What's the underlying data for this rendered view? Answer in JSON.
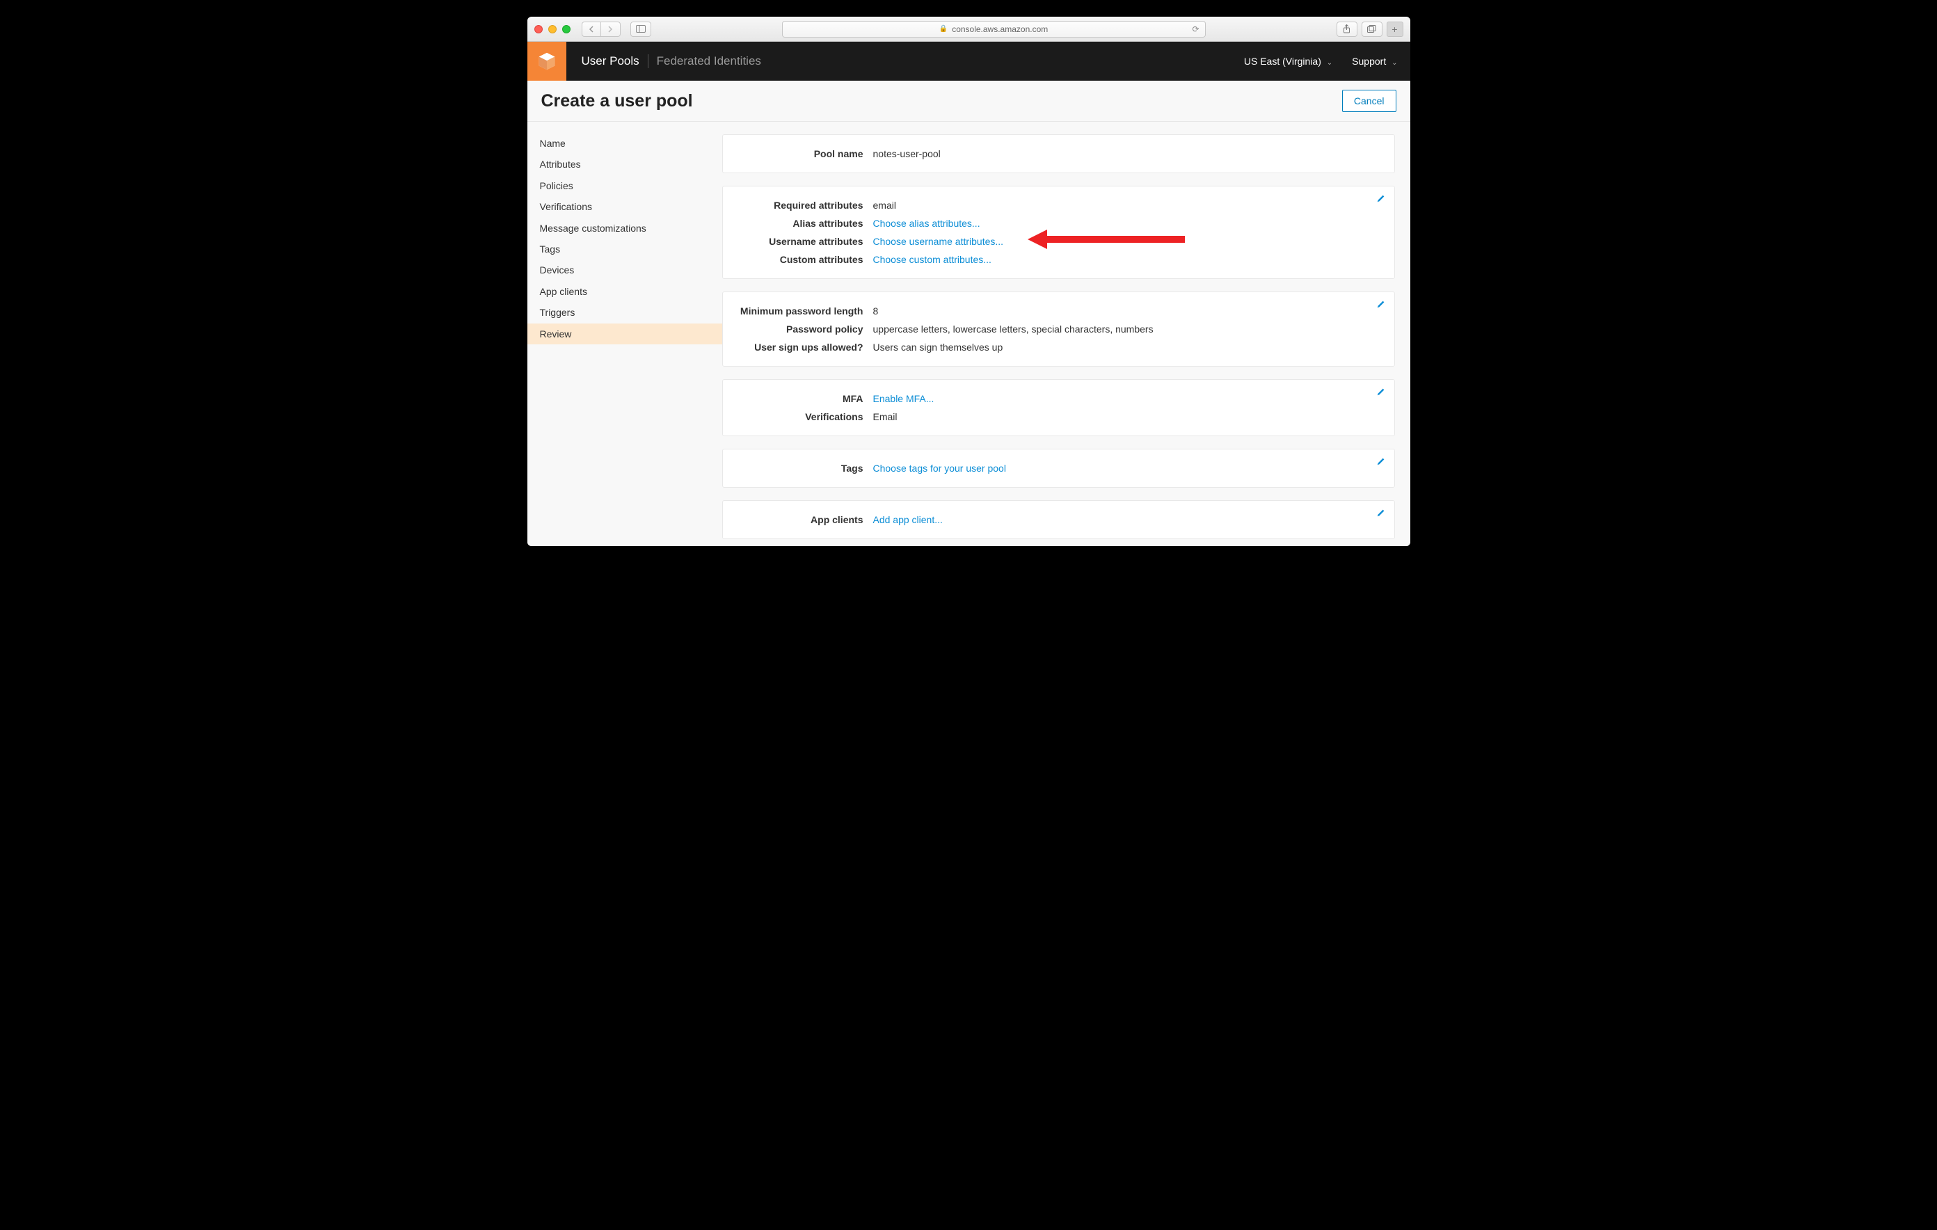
{
  "browser": {
    "url_host": "console.aws.amazon.com"
  },
  "aws_header": {
    "nav_primary": "User Pools",
    "nav_secondary": "Federated Identities",
    "region": "US East (Virginia)",
    "support": "Support"
  },
  "subheader": {
    "title": "Create a user pool",
    "cancel": "Cancel"
  },
  "sidebar": {
    "items": [
      "Name",
      "Attributes",
      "Policies",
      "Verifications",
      "Message customizations",
      "Tags",
      "Devices",
      "App clients",
      "Triggers",
      "Review"
    ],
    "active_index": 9
  },
  "cards": {
    "pool": {
      "name_label": "Pool name",
      "name_value": "notes-user-pool"
    },
    "attributes": {
      "required_label": "Required attributes",
      "required_value": "email",
      "alias_label": "Alias attributes",
      "alias_link": "Choose alias attributes...",
      "username_label": "Username attributes",
      "username_link": "Choose username attributes...",
      "custom_label": "Custom attributes",
      "custom_link": "Choose custom attributes..."
    },
    "policies": {
      "minlen_label": "Minimum password length",
      "minlen_value": "8",
      "policy_label": "Password policy",
      "policy_value": "uppercase letters, lowercase letters, special characters, numbers",
      "signup_label": "User sign ups allowed?",
      "signup_value": "Users can sign themselves up"
    },
    "mfa": {
      "mfa_label": "MFA",
      "mfa_link": "Enable MFA...",
      "verif_label": "Verifications",
      "verif_value": "Email"
    },
    "tags": {
      "tags_label": "Tags",
      "tags_link": "Choose tags for your user pool"
    },
    "appclients": {
      "label": "App clients",
      "link": "Add app client..."
    }
  }
}
